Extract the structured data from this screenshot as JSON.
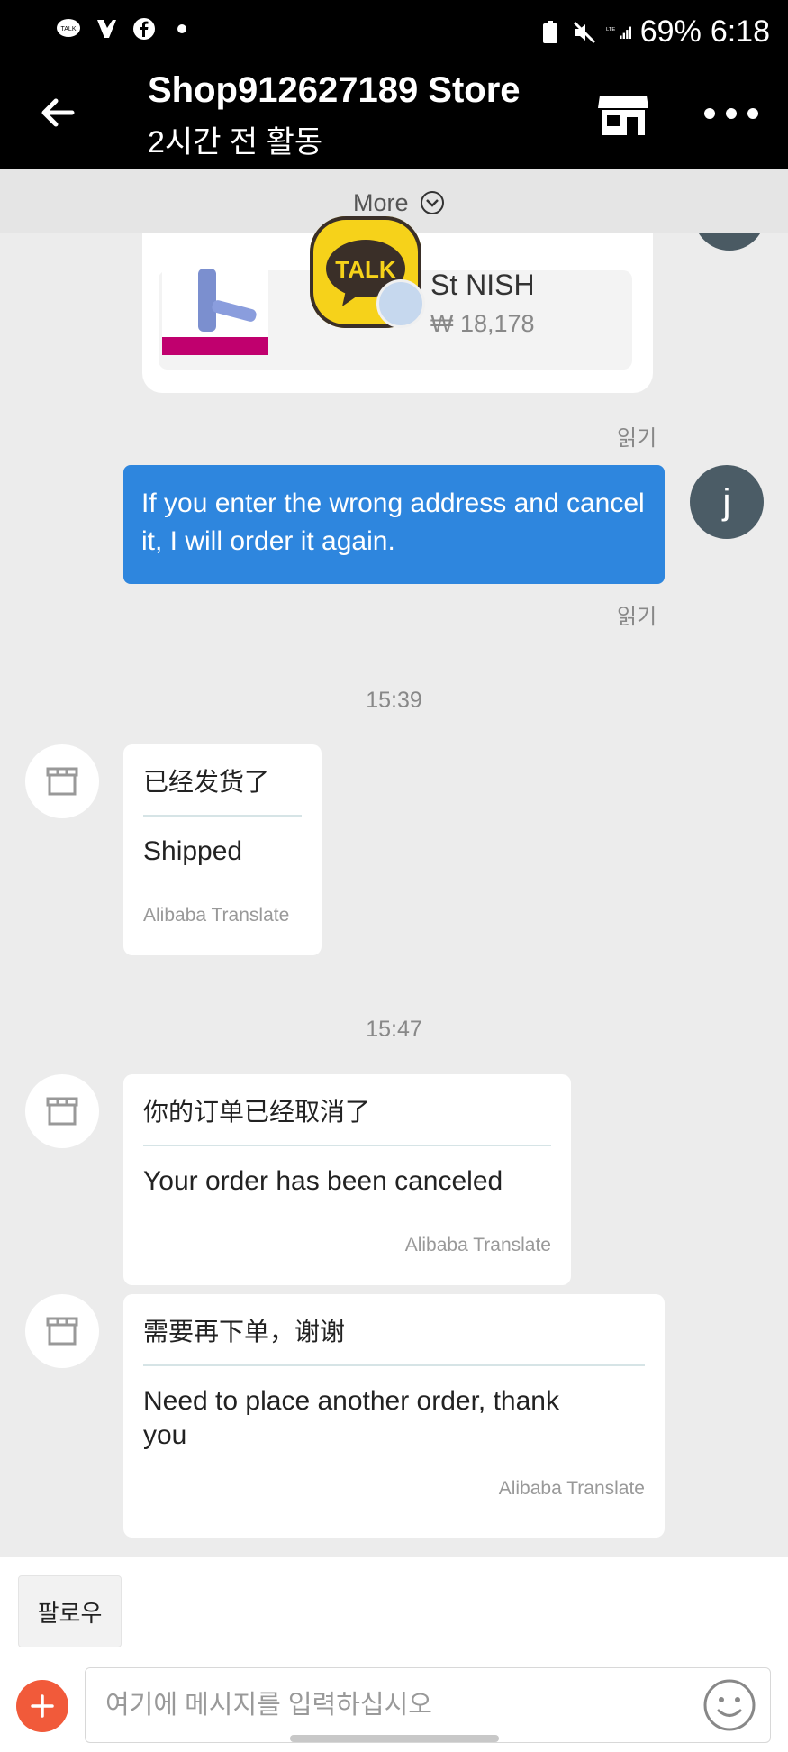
{
  "status_bar": {
    "battery": "69%",
    "time": "6:18"
  },
  "header": {
    "title": "Shop912627189 Store",
    "subtitle": "2시간 전 활동"
  },
  "more": {
    "label": "More"
  },
  "product": {
    "name": "St      NISH",
    "price": "₩ 18,178"
  },
  "messages": {
    "read1": "읽기",
    "my_message": "If you enter the wrong address and cancel it, I will order it again.",
    "my_avatar_letter": "j",
    "read2": "읽기",
    "time1": "15:39",
    "msg1": {
      "zh": "已经发货了",
      "en": "Shipped",
      "translator": "Alibaba Translate"
    },
    "time2": "15:47",
    "msg2": {
      "zh": "你的订单已经取消了",
      "en": "Your order has been canceled",
      "translator": "Alibaba Translate"
    },
    "msg3": {
      "zh": "需要再下单，谢谢",
      "en": "Need to place another order, thank you",
      "translator": "Alibaba Translate"
    }
  },
  "bottom": {
    "follow_label": "팔로우",
    "input_placeholder": "여기에 메시지를 입력하십시오"
  },
  "overlay": {
    "kakao_label": "TALK"
  },
  "colors": {
    "accent_blue": "#2e86de",
    "plus_button": "#f15a3a"
  }
}
